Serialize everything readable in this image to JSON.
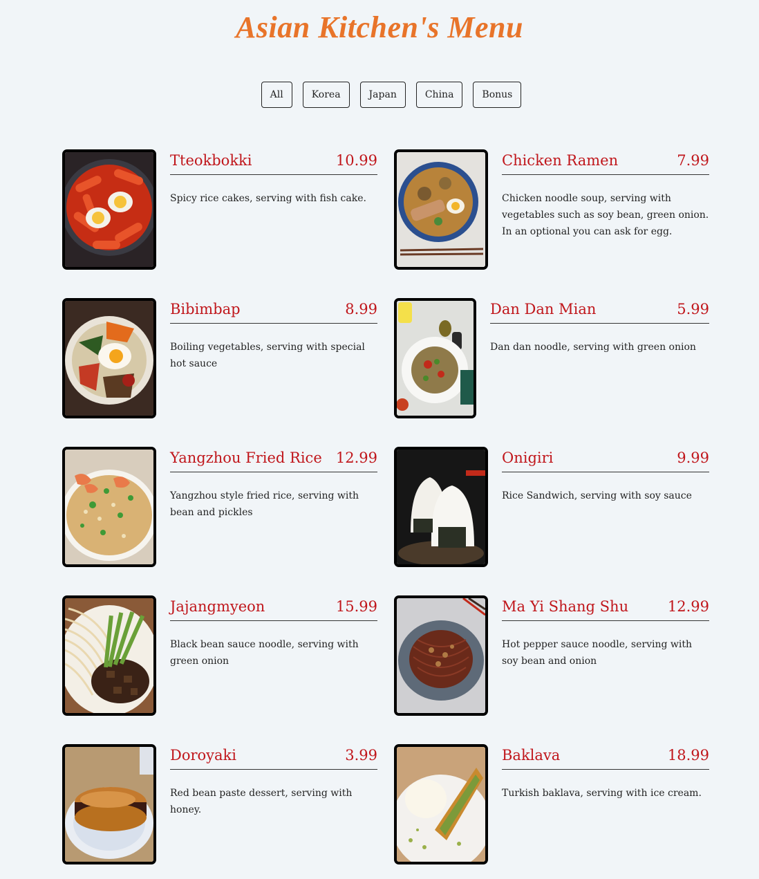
{
  "header": {
    "title": "Asian Kitchen's Menu"
  },
  "filters": [
    {
      "label": "All"
    },
    {
      "label": "Korea"
    },
    {
      "label": "Japan"
    },
    {
      "label": "China"
    },
    {
      "label": "Bonus"
    }
  ],
  "items": [
    {
      "name": "Tteokbokki",
      "price": "10.99",
      "desc": "Spicy rice cakes, serving with fish cake.",
      "image": "tteokbokki-photo"
    },
    {
      "name": "Chicken Ramen",
      "price": "7.99",
      "desc": "Chicken noodle soup, serving with vegetables such as soy bean, green onion. In an optional you can ask for egg.",
      "image": "chicken-ramen-photo"
    },
    {
      "name": "Bibimbap",
      "price": "8.99",
      "desc": "Boiling vegetables, serving with special hot sauce",
      "image": "bibimbap-photo"
    },
    {
      "name": "Dan Dan Mian",
      "price": "5.99",
      "desc": "Dan dan noodle, serving with green onion",
      "image": "dan-dan-mian-photo"
    },
    {
      "name": "Yangzhou Fried Rice",
      "price": "12.99",
      "desc": "Yangzhou style fried rice, serving with bean and pickles",
      "image": "fried-rice-photo"
    },
    {
      "name": "Onigiri",
      "price": "9.99",
      "desc": "Rice Sandwich, serving with soy sauce",
      "image": "onigiri-photo"
    },
    {
      "name": "Jajangmyeon",
      "price": "15.99",
      "desc": "Black bean sauce noodle, serving with green onion",
      "image": "jajangmyeon-photo"
    },
    {
      "name": "Ma Yi Shang Shu",
      "price": "12.99",
      "desc": "Hot pepper sauce noodle, serving with soy bean and onion",
      "image": "ma-yi-shang-shu-photo"
    },
    {
      "name": "Doroyaki",
      "price": "3.99",
      "desc": "Red bean paste dessert, serving with honey.",
      "image": "doroyaki-photo"
    },
    {
      "name": "Baklava",
      "price": "18.99",
      "desc": "Turkish baklava, serving with ice cream.",
      "image": "baklava-photo"
    }
  ],
  "colors": {
    "title": "#e8742a",
    "accent": "#c0161b",
    "background": "#f1f5f8"
  }
}
